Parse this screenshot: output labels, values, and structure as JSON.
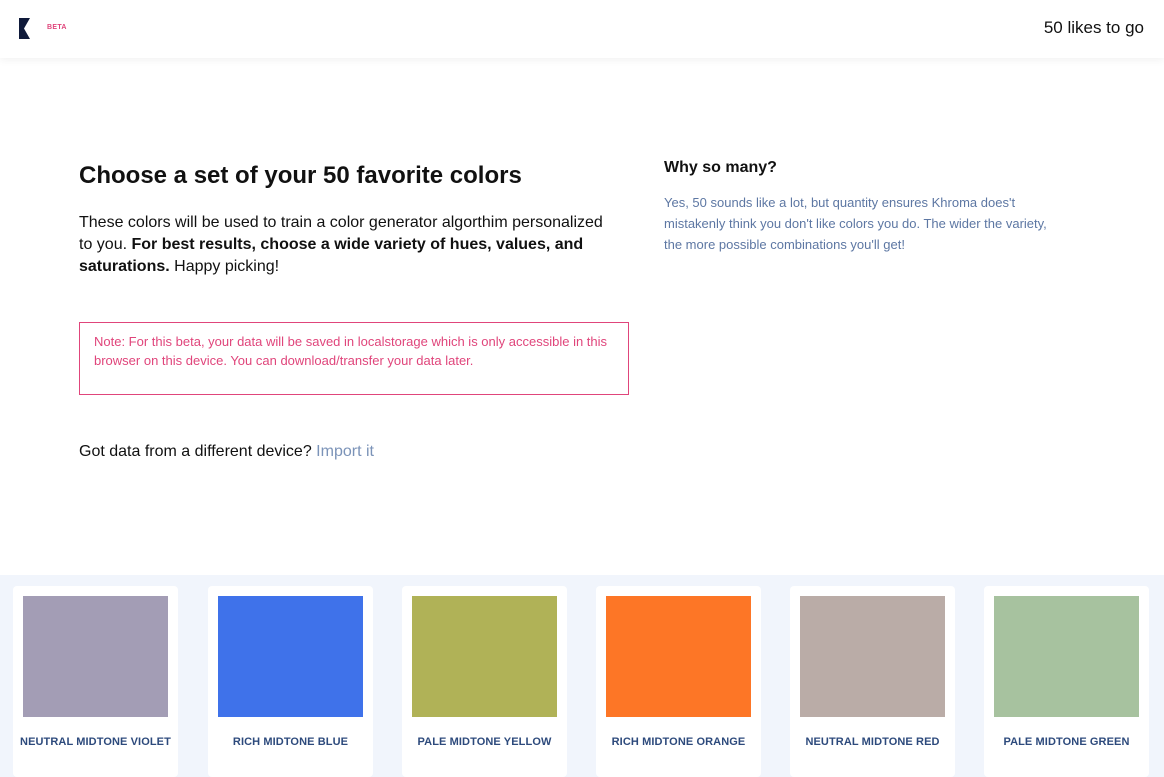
{
  "theme": {
    "accent": "#e0457b",
    "navy": "#0f1a3a",
    "label_blue": "#2d4a7c",
    "muted_text": "#5d77a3",
    "link": "#7b93b8",
    "strip_bg": "#f1f5fc"
  },
  "header": {
    "logo_icon": "khroma-k-logo-icon",
    "badge": "BETA",
    "likes_status": "50 likes to go"
  },
  "main": {
    "title": "Choose a set of your 50 favorite colors",
    "intro_plain": "These colors will be used to train a color generator algorthim personalized to you. ",
    "intro_bold": "For best results, choose a wide variety of hues, values, and saturations.",
    "intro_end": " Happy picking!",
    "note": "Note: For this beta, your data will be saved in localstorage which is only accessible in this browser on this device. You can download/transfer your data later.",
    "import_prompt": "Got data from a different device? ",
    "import_link": "Import it"
  },
  "sidebar": {
    "title": "Why so many?",
    "text": "Yes, 50 sounds like a lot, but quantity ensures Khroma does't mistakenly think you don't like colors you do. The wider the variety, the more possible combinations you'll get!"
  },
  "colors": [
    {
      "label": "NEUTRAL MIDTONE VIOLET",
      "hex": "#a39db5"
    },
    {
      "label": "RICH MIDTONE BLUE",
      "hex": "#3f72ea"
    },
    {
      "label": "PALE MIDTONE YELLOW",
      "hex": "#b0b257"
    },
    {
      "label": "RICH MIDTONE ORANGE",
      "hex": "#fd7626"
    },
    {
      "label": "NEUTRAL MIDTONE RED",
      "hex": "#baaca7"
    },
    {
      "label": "PALE MIDTONE GREEN",
      "hex": "#a7c29f"
    }
  ]
}
